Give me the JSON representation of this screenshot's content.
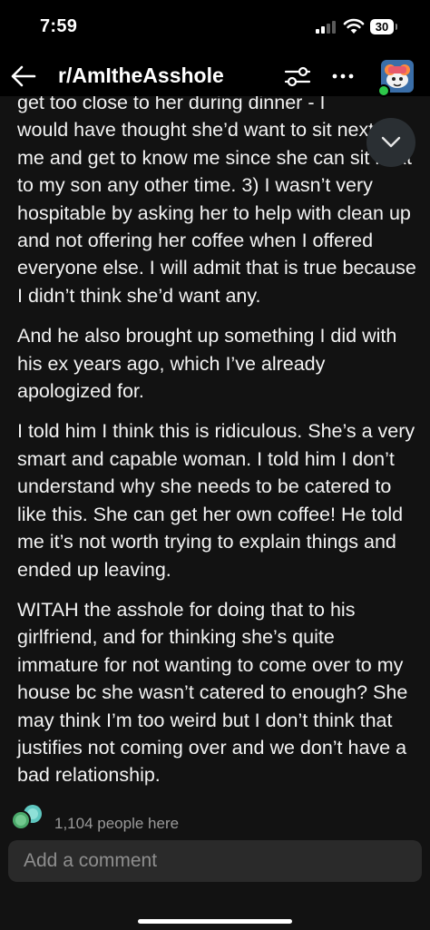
{
  "status_bar": {
    "time": "7:59",
    "battery": "30"
  },
  "header": {
    "subreddit": "r/AmItheAsshole",
    "back_icon": "arrow-left-icon",
    "filter_icon": "sliders-icon",
    "more_icon": "ellipsis-icon",
    "avatar_icon": "snoo-avatar-icon"
  },
  "post": {
    "partial_line": "get too close to her during dinner - I",
    "paragraphs": [
      "would have thought she’d want to sit next to me and get to know me since she can sit next to my son any other time. 3) I wasn’t very hospitable by asking her to help with clean up and not offering her coffee when I offered everyone else. I will admit that is true because I didn’t think she’d want any.",
      "And he also brought up something I did with his ex years ago, which I’ve already apologized for.",
      "I told him I think this is ridiculous. She’s a very smart and capable woman. I told him I don’t understand why she needs to be catered to like this. She can get her own coffee! He told me it’s not worth trying to explain things and ended up leaving.",
      "WITAH the asshole for doing that to his girlfriend, and for thinking she’s quite immature for not wanting to come over to my house bc she wasn’t catered to enough? She may think I’m too weird but I don’t think that justifies not coming over and we don’t have a bad relationship."
    ]
  },
  "footer": {
    "people_here": "1,104 people here",
    "comment_placeholder": "Add a comment"
  },
  "colors": {
    "background": "#121212",
    "header": "#000000",
    "text": "#f2f2f2",
    "muted": "#9a9a9a",
    "input_bg": "#2a2a2a",
    "online": "#2ec84a"
  }
}
